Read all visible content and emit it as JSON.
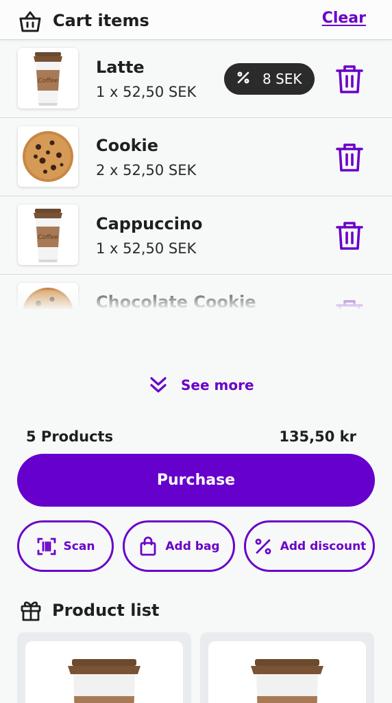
{
  "header": {
    "title": "Cart items",
    "clear_label": "Clear",
    "icon": "basket-icon"
  },
  "cart": {
    "items": [
      {
        "name": "Latte",
        "price": "1 x 52,50 SEK",
        "image": "coffee-cup",
        "discount": "8 SEK"
      },
      {
        "name": "Cookie",
        "price": "2 x 52,50 SEK",
        "image": "cookie"
      },
      {
        "name": "Cappuccino",
        "price": "1 x 52,50 SEK",
        "image": "coffee-cup"
      },
      {
        "name": "Chocolate Cookie",
        "image": "cookie"
      }
    ]
  },
  "see_more_label": "See more",
  "summary": {
    "count": "5 Products",
    "total": "135,50 kr"
  },
  "purchase_label": "Purchase",
  "actions": {
    "scan": "Scan",
    "add_bag": "Add bag",
    "add_discount": "Add discount"
  },
  "product_list": {
    "title": "Product list",
    "icon": "gift-icon"
  },
  "colors": {
    "accent": "#6600cc",
    "pill": "#2b2b2b",
    "background": "#f7f9f8"
  }
}
